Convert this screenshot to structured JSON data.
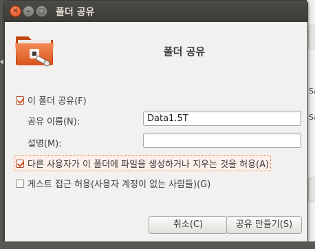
{
  "window": {
    "title": "폴더 공유"
  },
  "heading": "폴더 공유",
  "share_folder_check": {
    "label": "이 폴더 공유(F)",
    "checked": true
  },
  "share_name": {
    "label": "공유 이름(N):",
    "value": "Data1.5T"
  },
  "comment": {
    "label": "설명(M):",
    "value": ""
  },
  "allow_write_check": {
    "label": "다른 사용자가 이 폴더에 파일을 생성하거나 지우는 것을 허용(A)",
    "checked": true
  },
  "guest_access_check": {
    "label": "게스트 접근 허용(사용자 계정이 없는 사람들)(G)",
    "checked": false
  },
  "buttons": {
    "cancel": "취소(C)",
    "create": "공유 만들기(S)"
  },
  "background_app": {
    "text_a": "Sa",
    "text_b": "Sa"
  },
  "colors": {
    "accent": "#f07746",
    "titlebar": "#3c3b37",
    "window_bg": "#f2f1f0"
  }
}
